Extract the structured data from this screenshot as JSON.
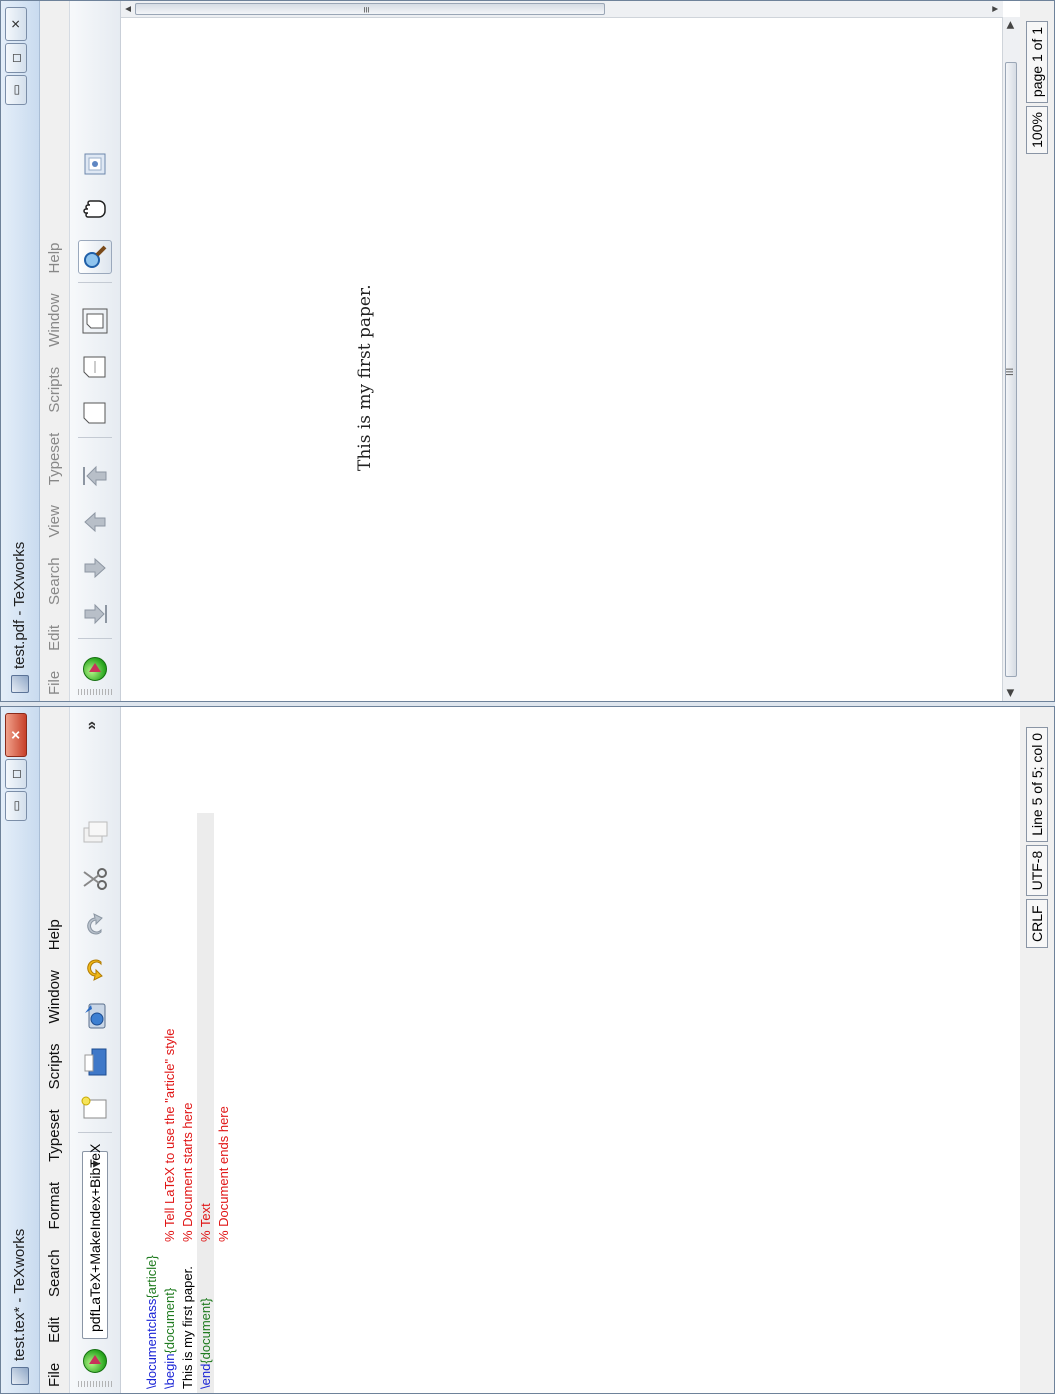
{
  "source_window": {
    "title": "test.tex* - TeXworks",
    "controls": {
      "minimize": "▭",
      "maximize": "◻",
      "close": "✕"
    },
    "menu": [
      "File",
      "Edit",
      "Search",
      "Format",
      "Typeset",
      "Scripts",
      "Window",
      "Help"
    ],
    "toolbar": {
      "engine": "pdfLaTeX+MakeIndex+BibTeX",
      "more": "»",
      "icons": [
        "new-document-icon",
        "open-folder-icon",
        "save-icon",
        "undo-icon",
        "redo-icon",
        "cut-icon",
        "copy-icon"
      ]
    },
    "code_lines": [
      {
        "parts": [
          {
            "text": "\\documentclass",
            "kind": "kw"
          },
          {
            "text": "{article}",
            "kind": "grp"
          }
        ],
        "comment": "% Tell LaTeX to use the \"article\" style"
      },
      {
        "parts": [
          {
            "text": "\\begin",
            "kind": "kw"
          },
          {
            "text": "{document}",
            "kind": "grp"
          }
        ],
        "comment": "% Document starts here"
      },
      {
        "parts": [
          {
            "text": "This is my first paper.",
            "kind": "plain"
          }
        ],
        "comment": "% Text"
      },
      {
        "parts": [
          {
            "text": "\\end",
            "kind": "kw"
          },
          {
            "text": "{document}",
            "kind": "grp"
          }
        ],
        "comment": "% Document ends here"
      }
    ],
    "status": {
      "line_ending": "CRLF",
      "encoding": "UTF-8",
      "position": "Line 5 of 5; col 0"
    }
  },
  "pdf_window": {
    "title": "test.pdf - TeXworks",
    "controls": {
      "minimize": "▭",
      "maximize": "◻",
      "close": "✕"
    },
    "menu": [
      "File",
      "Edit",
      "Search",
      "View",
      "Typeset",
      "Scripts",
      "Window",
      "Help"
    ],
    "page_text": "This is my first paper.",
    "status": {
      "zoom": "100%",
      "page": "page 1 of 1"
    },
    "scroll": {
      "h_thumb_label": "III",
      "v_thumb_label": "≡"
    }
  },
  "colors": {
    "keyword": "#1a24d6",
    "group": "#1f7b1f",
    "comment": "#e01515"
  }
}
